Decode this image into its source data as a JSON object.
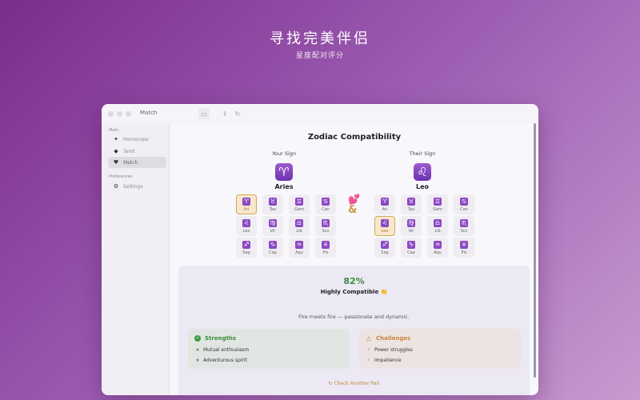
{
  "hero": {
    "title": "寻找完美伴侣",
    "subtitle": "星座配对评分"
  },
  "window": {
    "title": "Match"
  },
  "toolbar": {
    "sidebar_icon": "▭",
    "share_icon": "⇪",
    "refresh_icon": "↻"
  },
  "sidebar": {
    "section_main": "Main",
    "section_preferences": "Preferences",
    "items": [
      {
        "label": "Horoscope",
        "icon": "✦"
      },
      {
        "label": "Tarot",
        "icon": "◆"
      },
      {
        "label": "Match",
        "icon": "♥"
      },
      {
        "label": "Settings",
        "icon": "⚙"
      }
    ]
  },
  "main": {
    "title": "Zodiac Compatibility",
    "your_label": "Your Sign",
    "their_label": "Their Sign",
    "your_sign": {
      "glyph": "♈",
      "name": "Aries"
    },
    "their_sign": {
      "glyph": "♌",
      "name": "Leo"
    },
    "heart": "💕",
    "amp": "&"
  },
  "signs": [
    {
      "glyph": "♈",
      "abbr": "Ari"
    },
    {
      "glyph": "♉",
      "abbr": "Tau"
    },
    {
      "glyph": "♊",
      "abbr": "Gem"
    },
    {
      "glyph": "♋",
      "abbr": "Can"
    },
    {
      "glyph": "♌",
      "abbr": "Leo"
    },
    {
      "glyph": "♍",
      "abbr": "Vir"
    },
    {
      "glyph": "♎",
      "abbr": "Lib"
    },
    {
      "glyph": "♏",
      "abbr": "Sco"
    },
    {
      "glyph": "♐",
      "abbr": "Sag"
    },
    {
      "glyph": "♑",
      "abbr": "Cap"
    },
    {
      "glyph": "♒",
      "abbr": "Aqu"
    },
    {
      "glyph": "♓",
      "abbr": "Pis"
    }
  ],
  "selected": {
    "your": "Ari",
    "their": "Leo"
  },
  "result": {
    "percent": "82%",
    "verdict": "Highly Compatible",
    "verdict_emoji": "👏",
    "description": "Fire meets fire — passionate and dynamic.",
    "strengths": {
      "title": "Strengths",
      "icon": "✓",
      "items": [
        "Mutual enthusiasm",
        "Adventurous spirit"
      ],
      "item_icon": "★"
    },
    "challenges": {
      "title": "Challenges",
      "icon": "⚠",
      "items": [
        "Power struggles",
        "Impatience"
      ],
      "item_icon": "⚡"
    },
    "check_another": "Check Another Pair",
    "check_icon": "↻"
  }
}
